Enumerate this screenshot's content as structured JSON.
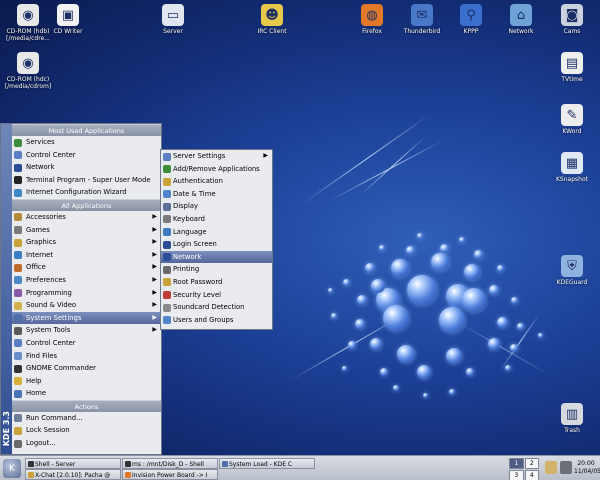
{
  "desktop": {
    "icons": [
      {
        "id": "cdrom1",
        "label": "CD-ROM (hdb)\n[/media/cdre...",
        "glyph": "disc-icon",
        "color": "#e8e8e8"
      },
      {
        "id": "cdwriter",
        "label": "CD Writer",
        "glyph": "roast-icon",
        "color": "#f2f2f2"
      },
      {
        "id": "server",
        "label": "Server",
        "glyph": "monitor-icon",
        "color": "#dfe6ef"
      },
      {
        "id": "irc",
        "label": "IRC Client",
        "glyph": "chat-icon",
        "color": "#e7c84a"
      },
      {
        "id": "firefox",
        "label": "Firefox",
        "glyph": "firefox-icon",
        "color": "#e2792a"
      },
      {
        "id": "thunderbird",
        "label": "Thunderbird",
        "glyph": "mail-icon",
        "color": "#4a78c9"
      },
      {
        "id": "kppp",
        "label": "KPPP",
        "glyph": "kppp-icon",
        "color": "#3a6fd0"
      },
      {
        "id": "network",
        "label": "Network",
        "glyph": "network-icon",
        "color": "#6fa3d8"
      },
      {
        "id": "cams",
        "label": "Cams",
        "glyph": "camera-icon",
        "color": "#c9d2de"
      },
      {
        "id": "cdrom2",
        "label": "CD-ROM (hdc)\n[/media/cdrom]",
        "glyph": "disc-icon",
        "color": "#e8e8e8"
      },
      {
        "id": "tvtime",
        "label": "TVtime",
        "glyph": "tv-icon",
        "color": "#f0f0f0"
      },
      {
        "id": "kword",
        "label": "KWord",
        "glyph": "kword-icon",
        "color": "#ececec"
      },
      {
        "id": "ksnapshot",
        "label": "KSnapshot",
        "glyph": "snapshot-icon",
        "color": "#dfe9f5"
      },
      {
        "id": "kdeguard",
        "label": "KDEGuard",
        "glyph": "guard-icon",
        "color": "#8fb2e0"
      },
      {
        "id": "trash",
        "label": "Trash",
        "glyph": "trash-icon",
        "color": "#d6d9de"
      }
    ]
  },
  "kmenu": {
    "sidebar_text": "KDE 3.3",
    "sections": [
      {
        "header": "Most Used Applications",
        "items": [
          {
            "label": "Services",
            "color": "#3c8d3a",
            "arrow": false
          },
          {
            "label": "Control Center",
            "color": "#5b7fc4",
            "arrow": false
          },
          {
            "label": "Network",
            "color": "#2b4f96",
            "arrow": false
          },
          {
            "label": "Terminal Program - Super User Mode",
            "color": "#222222",
            "arrow": false
          },
          {
            "label": "Internet Configuration Wizard",
            "color": "#3f8ac6",
            "arrow": false
          }
        ]
      },
      {
        "header": "All Applications",
        "items": [
          {
            "label": "Accessories",
            "color": "#b58b3a",
            "arrow": true
          },
          {
            "label": "Games",
            "color": "#7a7a7a",
            "arrow": true
          },
          {
            "label": "Graphics",
            "color": "#c9a23a",
            "arrow": true
          },
          {
            "label": "Internet",
            "color": "#3c7bc4",
            "arrow": true
          },
          {
            "label": "Office",
            "color": "#c26c2a",
            "arrow": true
          },
          {
            "label": "Preferences",
            "color": "#4e86c8",
            "arrow": true
          },
          {
            "label": "Programming",
            "color": "#8a5aa8",
            "arrow": true
          },
          {
            "label": "Sound & Video",
            "color": "#d1b24a",
            "arrow": true
          },
          {
            "label": "System Settings",
            "color": "#4e6fae",
            "arrow": true,
            "selected": true
          },
          {
            "label": "System Tools",
            "color": "#5a5a5a",
            "arrow": true
          },
          {
            "label": "Control Center",
            "color": "#5b7fc4",
            "arrow": false
          },
          {
            "label": "Find Files",
            "color": "#6a8ec9",
            "arrow": false
          },
          {
            "label": "GNOME Commander",
            "color": "#333333",
            "arrow": false
          },
          {
            "label": "Help",
            "color": "#d8b03a",
            "arrow": false
          },
          {
            "label": "Home",
            "color": "#4b74b8",
            "arrow": false
          }
        ]
      },
      {
        "header": "Actions",
        "items": [
          {
            "label": "Run Command...",
            "color": "#6f7f9a",
            "arrow": false
          },
          {
            "label": "Lock Session",
            "color": "#c9a23a",
            "arrow": false
          },
          {
            "label": "Logout...",
            "color": "#6a6a6a",
            "arrow": false
          }
        ]
      }
    ]
  },
  "submenu": {
    "items": [
      {
        "label": "Server Settings",
        "color": "#5b7fc4",
        "arrow": true
      },
      {
        "label": "Add/Remove Applications",
        "color": "#3c8d3a",
        "arrow": false
      },
      {
        "label": "Authentication",
        "color": "#c9a23a",
        "arrow": false
      },
      {
        "label": "Date & Time",
        "color": "#4e86c8",
        "arrow": false
      },
      {
        "label": "Display",
        "color": "#5a6f9a",
        "arrow": false
      },
      {
        "label": "Keyboard",
        "color": "#7a7a7a",
        "arrow": false
      },
      {
        "label": "Language",
        "color": "#3c7bc4",
        "arrow": false
      },
      {
        "label": "Login Screen",
        "color": "#2b4f96",
        "arrow": false
      },
      {
        "label": "Network",
        "color": "#2b4f96",
        "arrow": false,
        "selected": true
      },
      {
        "label": "Printing",
        "color": "#6a6a6a",
        "arrow": false
      },
      {
        "label": "Root Password",
        "color": "#c9a23a",
        "arrow": false
      },
      {
        "label": "Security Level",
        "color": "#c23a3a",
        "arrow": false
      },
      {
        "label": "Soundcard Detection",
        "color": "#8a8a8a",
        "arrow": false
      },
      {
        "label": "Users and Groups",
        "color": "#4e86c8",
        "arrow": false
      }
    ]
  },
  "taskbar": {
    "tasks": [
      {
        "label": "Shell - Server",
        "color": "#333333"
      },
      {
        "label": "X-Chat [2.0.10]: Pacha @",
        "color": "#c9a23a"
      },
      {
        "label": "ms : /mnt/Disk_D - Shell",
        "color": "#333333"
      },
      {
        "label": "Invision Power Board -> I",
        "color": "#e2792a"
      },
      {
        "label": "System Load - KDE C",
        "color": "#4e6fae"
      }
    ],
    "pager": [
      "1",
      "2",
      "3",
      "4"
    ],
    "clock_time": "20:00",
    "clock_date": "11/04/05"
  }
}
